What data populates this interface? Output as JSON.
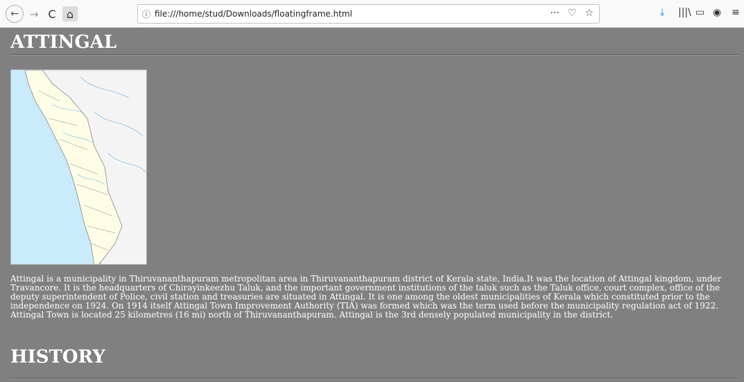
{
  "browser": {
    "url": "file:///home/stud/Downloads/floatingframe.html",
    "icons": {
      "back": "←",
      "forward": "→",
      "reload": "C",
      "home": "⌂",
      "info": "ⓘ",
      "more": "···",
      "pocket": "♡",
      "bookmark": "☆",
      "download": "⤓",
      "library": "|||\\",
      "sidebar": "▭",
      "account": "◉",
      "menu": "≡"
    }
  },
  "page": {
    "title1": "ATTINGAL",
    "paragraph": "Attingal is a municipality in Thiruvananthapuram metropolitan area in Thiruvananthapuram district of Kerala state, India.It was the location of Attingal kingdom, under Travancore. It is the headquarters of Chirayinkeezhu Taluk, and the important government institutions of the taluk such as the Taluk office, court complex, office of the deputy superintendent of Police, civil station and treasuries are situated in Attingal. It is one among the oldest municipalities of Kerala which constituted prior to the independence on 1924. On 1914 itself Attingal Town Improvement Authority (TIA) was formed which was the term used before the municipality regulation act of 1922. Attingal Town is located 25 kilometres (16 mi) north of Thiruvananthapuram. Attingal is the 3rd densely populated municipality in the district.",
    "title2": "HISTORY"
  }
}
